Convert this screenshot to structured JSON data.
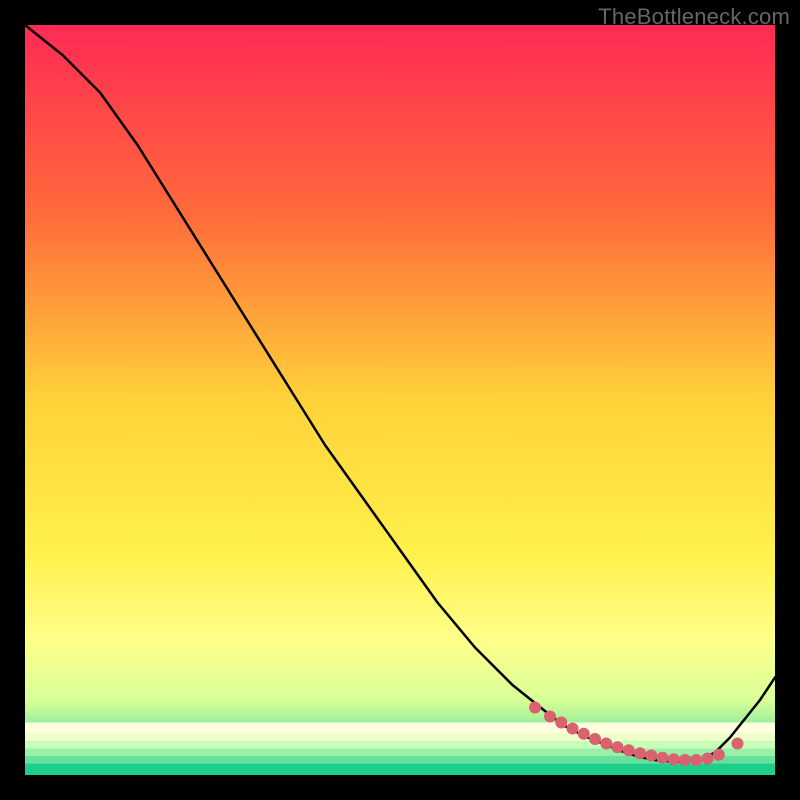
{
  "watermark": "TheBottleneck.com",
  "chart_data": {
    "type": "line",
    "title": "",
    "xlabel": "",
    "ylabel": "",
    "xlim": [
      0,
      100
    ],
    "ylim": [
      0,
      100
    ],
    "grid": false,
    "series": [
      {
        "name": "curve",
        "color": "#000000",
        "x": [
          0,
          5,
          10,
          15,
          20,
          25,
          30,
          35,
          40,
          45,
          50,
          55,
          60,
          65,
          70,
          72,
          75,
          78,
          80,
          82,
          84,
          86,
          88,
          90,
          92,
          94,
          96,
          98,
          100
        ],
        "y": [
          100,
          96,
          91,
          84,
          76,
          68,
          60,
          52,
          44,
          37,
          30,
          23,
          17,
          12,
          8,
          6.5,
          5,
          3.8,
          3,
          2.4,
          2,
          1.8,
          1.8,
          2,
          3,
          5,
          7.5,
          10,
          13
        ]
      }
    ],
    "points": {
      "name": "markers",
      "color": "#d9626e",
      "x": [
        68,
        70,
        71.5,
        73,
        74.5,
        76,
        77.5,
        79,
        80.5,
        82,
        83.5,
        85,
        86.5,
        88,
        89.5,
        91,
        92.5,
        95
      ],
      "y": [
        9,
        7.8,
        7,
        6.2,
        5.5,
        4.8,
        4.2,
        3.7,
        3.3,
        2.9,
        2.6,
        2.3,
        2.1,
        2,
        2,
        2.2,
        2.7,
        4.2
      ]
    },
    "gradient_stops": [
      {
        "offset": 0,
        "color": "#ff2a55"
      },
      {
        "offset": 0.25,
        "color": "#ff6a3a"
      },
      {
        "offset": 0.5,
        "color": "#ffd23a"
      },
      {
        "offset": 0.7,
        "color": "#fff04a"
      },
      {
        "offset": 0.82,
        "color": "#ffff8a"
      },
      {
        "offset": 0.9,
        "color": "#d9ff99"
      },
      {
        "offset": 0.96,
        "color": "#66e09a"
      },
      {
        "offset": 1.0,
        "color": "#1ecf8c"
      }
    ],
    "background_stripes": [
      {
        "y0": 0.93,
        "y1": 0.945,
        "color": "#ffffe0"
      },
      {
        "y0": 0.945,
        "y1": 0.955,
        "color": "#eeffc8"
      },
      {
        "y0": 0.955,
        "y1": 0.965,
        "color": "#c8ffb8"
      },
      {
        "y0": 0.965,
        "y1": 0.975,
        "color": "#99f0a8"
      },
      {
        "y0": 0.975,
        "y1": 0.985,
        "color": "#66e09a"
      },
      {
        "y0": 0.985,
        "y1": 1.0,
        "color": "#1ecf8c"
      }
    ]
  }
}
